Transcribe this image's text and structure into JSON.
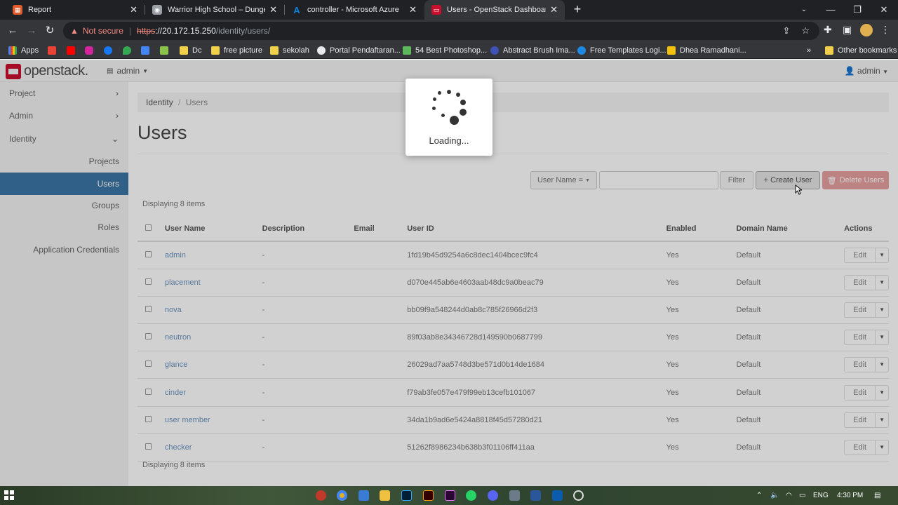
{
  "browser": {
    "tabs": [
      {
        "title": "Report",
        "favicon_color": "#e05a2b",
        "active": false
      },
      {
        "title": "Warrior High School – Dungeon",
        "favicon_color": "#9aa0a6",
        "active": false
      },
      {
        "title": "controller - Microsoft Azure",
        "favicon_color": "#0078d4",
        "active": false
      },
      {
        "title": "Users - OpenStack Dashboard",
        "favicon_color": "#c8102e",
        "active": true
      }
    ],
    "url": {
      "security_label": "Not secure",
      "scheme": "https",
      "host": "://20.172.15.250",
      "path": "/identity/users/"
    },
    "bookmarks": [
      {
        "label": "Apps",
        "icon": "apps-grid-icon"
      },
      {
        "label": "",
        "icon": "gmail-icon"
      },
      {
        "label": "",
        "icon": "youtube-icon"
      },
      {
        "label": "",
        "icon": "instagram-icon"
      },
      {
        "label": "",
        "icon": "facebook-icon"
      },
      {
        "label": "",
        "icon": "maps-icon"
      },
      {
        "label": "",
        "icon": "translate-icon"
      },
      {
        "label": "",
        "icon": "photo-icon"
      },
      {
        "label": "Dc",
        "icon": "folder-icon"
      },
      {
        "label": "free picture",
        "icon": "folder-icon"
      },
      {
        "label": "sekolah",
        "icon": "folder-icon"
      },
      {
        "label": "Portal Pendaftaran...",
        "icon": "globe-icon"
      },
      {
        "label": "54 Best Photoshop...",
        "icon": "photoshop-site-icon"
      },
      {
        "label": "Abstract Brush Ima...",
        "icon": "brush-site-icon"
      },
      {
        "label": "Free Templates Logi...",
        "icon": "template-site-icon"
      },
      {
        "label": "Dhea Ramadhani...",
        "icon": "doc-icon"
      }
    ],
    "more_bookmarks": "»",
    "other_bookmarks": "Other bookmarks"
  },
  "header": {
    "brand": "openstack.",
    "project": "admin",
    "user": "admin"
  },
  "sidebar": {
    "sections": [
      {
        "label": "Project",
        "expanded": false
      },
      {
        "label": "Admin",
        "expanded": false
      },
      {
        "label": "Identity",
        "expanded": true
      }
    ],
    "items": [
      {
        "label": "Projects",
        "active": false
      },
      {
        "label": "Users",
        "active": true
      },
      {
        "label": "Groups",
        "active": false
      },
      {
        "label": "Roles",
        "active": false
      },
      {
        "label": "Application Credentials",
        "active": false
      }
    ]
  },
  "main": {
    "breadcrumb": {
      "parent": "Identity",
      "separator": "/",
      "current": "Users"
    },
    "title": "Users",
    "filter_field": "User Name =",
    "filter_button": "Filter",
    "create_button": "+ Create User",
    "delete_button": "Delete Users",
    "count_label": "Displaying 8 items",
    "columns": [
      "User Name",
      "Description",
      "Email",
      "User ID",
      "Enabled",
      "Domain Name",
      "Actions"
    ],
    "edit_label": "Edit",
    "rows": [
      {
        "name": "admin",
        "description": "-",
        "email": "",
        "id": "1fd19b45d9254a6c8dec1404bcec9fc4",
        "enabled": "Yes",
        "domain": "Default"
      },
      {
        "name": "placement",
        "description": "-",
        "email": "",
        "id": "d070e445ab6e4603aab48dc9a0beac79",
        "enabled": "Yes",
        "domain": "Default"
      },
      {
        "name": "nova",
        "description": "-",
        "email": "",
        "id": "bb09f9a548244d0ab8c785f26966d2f3",
        "enabled": "Yes",
        "domain": "Default"
      },
      {
        "name": "neutron",
        "description": "-",
        "email": "",
        "id": "89f03ab8e34346728d149590b0687799",
        "enabled": "Yes",
        "domain": "Default"
      },
      {
        "name": "glance",
        "description": "-",
        "email": "",
        "id": "26029ad7aa5748d3be571d0b14de1684",
        "enabled": "Yes",
        "domain": "Default"
      },
      {
        "name": "cinder",
        "description": "-",
        "email": "",
        "id": "f79ab3fe057e479f99eb13cefb101067",
        "enabled": "Yes",
        "domain": "Default"
      },
      {
        "name": "user member",
        "description": "-",
        "email": "",
        "id": "34da1b9ad6e5424a8818f45d57280d21",
        "enabled": "Yes",
        "domain": "Default"
      },
      {
        "name": "checker",
        "description": "-",
        "email": "",
        "id": "51262f8986234b638b3f01106ff411aa",
        "enabled": "Yes",
        "domain": "Default"
      }
    ]
  },
  "loading": {
    "text": "Loading..."
  },
  "taskbar": {
    "language": "ENG",
    "time": "4:30 PM"
  }
}
